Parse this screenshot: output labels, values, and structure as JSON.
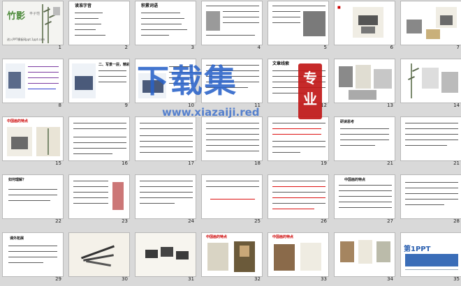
{
  "cover": {
    "title": "竹影",
    "subtitle": "丰子恺",
    "footer": "进入PPT模板网ppt.1ppt.com"
  },
  "slides": [
    {
      "n": "1"
    },
    {
      "n": "2",
      "title": "读准字音"
    },
    {
      "n": "3",
      "title": "积累词语"
    },
    {
      "n": "4"
    },
    {
      "n": "5"
    },
    {
      "n": "6"
    },
    {
      "n": "7"
    },
    {
      "n": "8"
    },
    {
      "n": "9",
      "title": "二、写景一层，精彩品读"
    },
    {
      "n": "10"
    },
    {
      "n": "11",
      "title": "文章线索"
    },
    {
      "n": "12",
      "title": "专业"
    },
    {
      "n": "13"
    },
    {
      "n": "14"
    },
    {
      "n": "15",
      "title": "中国画的特点"
    },
    {
      "n": "16"
    },
    {
      "n": "17"
    },
    {
      "n": "18"
    },
    {
      "n": "19"
    },
    {
      "n": "20",
      "title": "研读思考"
    },
    {
      "n": "21"
    },
    {
      "n": "22",
      "title": "如何理解？"
    },
    {
      "n": "23"
    },
    {
      "n": "24"
    },
    {
      "n": "25"
    },
    {
      "n": "26"
    },
    {
      "n": "27",
      "title": "中国画的特点"
    },
    {
      "n": "28"
    },
    {
      "n": "29",
      "title": "课外拓展"
    },
    {
      "n": "30"
    },
    {
      "n": "31"
    },
    {
      "n": "32",
      "title": "中国画的特点"
    },
    {
      "n": "33",
      "title": "中国画的特点"
    },
    {
      "n": "34"
    },
    {
      "n": "35",
      "title": "第1PPT"
    }
  ],
  "watermark": {
    "main": "下载集",
    "url": "www.xiazaiji.red",
    "seal": "专业"
  },
  "colors": {
    "accent": "#2a63c9",
    "seal": "#c21818",
    "cover_green": "#4c8a3a"
  }
}
